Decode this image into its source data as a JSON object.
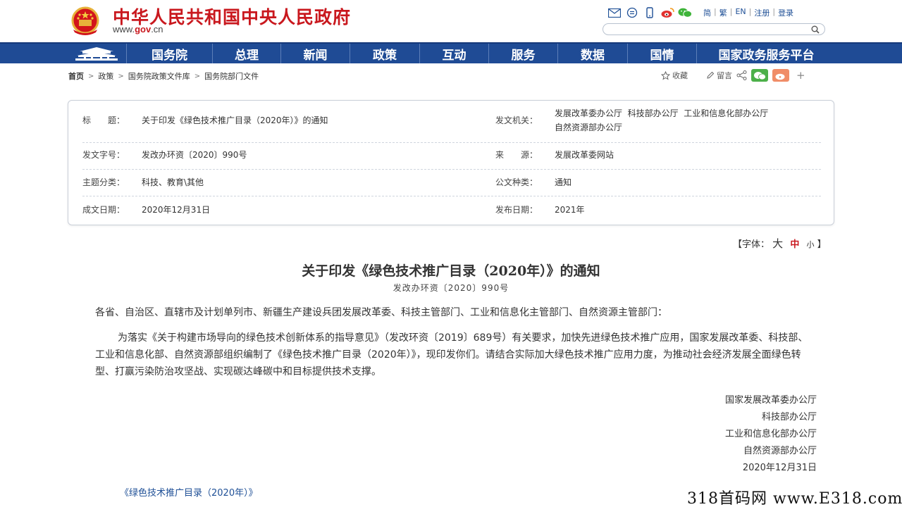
{
  "header": {
    "site_title": "中华人民共和国中央人民政府",
    "site_url_prefix": "www.",
    "site_url_brand": "gov",
    "site_url_suffix": ".cn",
    "lang_links": [
      "简",
      "繁",
      "EN",
      "注册",
      "登录"
    ],
    "search_placeholder": ""
  },
  "nav": {
    "items": [
      "国务院",
      "总理",
      "新闻",
      "政策",
      "互动",
      "服务",
      "数据",
      "国情",
      "国家政务服务平台"
    ]
  },
  "breadcrumb": [
    "首页",
    "政策",
    "国务院政策文件库",
    "国务院部门文件"
  ],
  "share": {
    "favorite": "收藏",
    "comment": "留言"
  },
  "meta": {
    "title_label": "标　　题：",
    "title_value": "关于印发《绿色技术推广目录（2020年）》的通知",
    "issuer_label": "发文机关：",
    "issuer_line1": "发展改革委办公厅  科技部办公厅  工业和信息化部办公厅",
    "issuer_line2": "自然资源部办公厅",
    "docno_label": "发文字号：",
    "docno_value": "发改办环资〔2020〕990号",
    "source_label": "来　　源：",
    "source_value": "发展改革委网站",
    "topic_label": "主题分类：",
    "topic_value": "科技、教育\\其他",
    "type_label": "公文种类：",
    "type_value": "通知",
    "date_label": "成文日期：",
    "date_value": "2020年12月31日",
    "pub_label": "发布日期：",
    "pub_value": "2021年"
  },
  "font_toggle": {
    "prefix": "【字体：",
    "large": "大",
    "medium": "中",
    "small": "小",
    "suffix": "】"
  },
  "article": {
    "title": "关于印发《绿色技术推广目录（2020年）》的通知",
    "doc_number": "发改办环资〔2020〕990号",
    "salutation": "各省、自治区、直辖市及计划单列市、新疆生产建设兵团发展改革委、科技主管部门、工业和信息化主管部门、自然资源主管部门：",
    "body": "为落实《关于构建市场导向的绿色技术创新体系的指导意见》（发改环资〔2019〕689号）有关要求，加快先进绿色技术推广应用，国家发展改革委、科技部、工业和信息化部、自然资源部组织编制了《绿色技术推广目录（2020年）》，现印发你们。请结合实际加大绿色技术推广应用力度，为推动社会经济发展全面绿色转型、打赢污染防治攻坚战、实现碳达峰碳中和目标提供技术支撑。",
    "signatures": [
      "国家发展改革委办公厅",
      "科技部办公厅",
      "工业和信息化部办公厅",
      "自然资源部办公厅",
      "2020年12月31日"
    ],
    "attachment": "《绿色技术推广目录（2020年）》"
  },
  "watermark": "318首码网 www.E318.com"
}
